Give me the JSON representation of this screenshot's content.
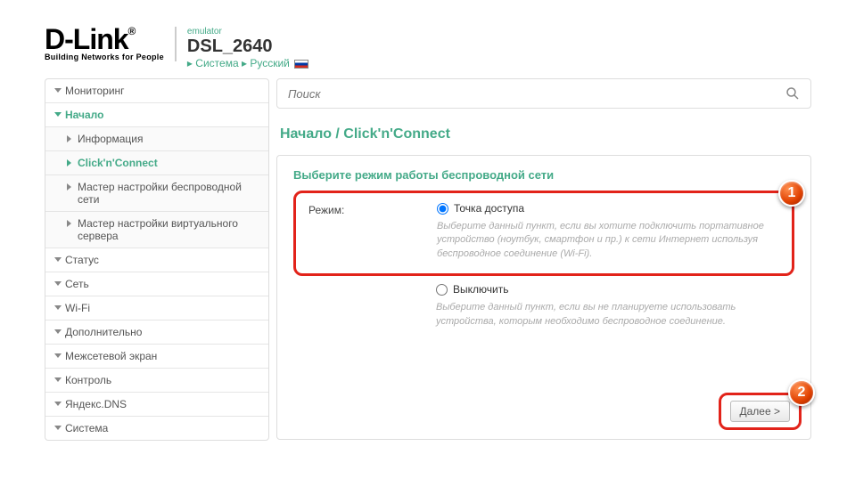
{
  "header": {
    "brand": "D-Link",
    "brand_sup": "®",
    "tagline": "Building Networks for People",
    "emulator": "emulator",
    "model": "DSL_2640",
    "crumb_system": "Система",
    "crumb_lang": "Русский"
  },
  "sidebar": {
    "items": [
      {
        "label": "Мониторинг",
        "type": "top"
      },
      {
        "label": "Начало",
        "type": "top",
        "open": true
      },
      {
        "label": "Информация",
        "type": "sub"
      },
      {
        "label": "Click'n'Connect",
        "type": "sub",
        "active": true
      },
      {
        "label": "Мастер настройки беспроводной сети",
        "type": "sub"
      },
      {
        "label": "Мастер настройки виртуального сервера",
        "type": "sub"
      },
      {
        "label": "Статус",
        "type": "top"
      },
      {
        "label": "Сеть",
        "type": "top"
      },
      {
        "label": "Wi-Fi",
        "type": "top"
      },
      {
        "label": "Дополнительно",
        "type": "top"
      },
      {
        "label": "Межсетевой экран",
        "type": "top"
      },
      {
        "label": "Контроль",
        "type": "top"
      },
      {
        "label": "Яндекс.DNS",
        "type": "top"
      },
      {
        "label": "Система",
        "type": "top"
      }
    ]
  },
  "search": {
    "placeholder": "Поиск"
  },
  "breadcrumb": "Начало /  Click'n'Connect",
  "panel": {
    "title": "Выберите режим работы беспроводной сети",
    "mode_label": "Режим:",
    "option1_label": "Точка доступа",
    "option1_hint": "Выберите данный пункт, если вы хотите подключить портативное устройство (ноутбук, смартфон и пр.) к сети Интернет используя беспроводное соединение (Wi-Fi).",
    "option2_label": "Выключить",
    "option2_hint": "Выберите данный пункт, если вы не планируете использовать устройства, которым необходимо беспроводное соединение.",
    "next_label": "Далее >"
  },
  "badges": {
    "one": "1",
    "two": "2"
  }
}
